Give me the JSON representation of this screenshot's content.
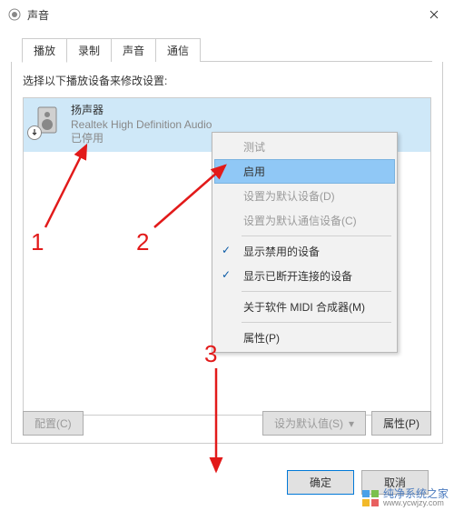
{
  "window": {
    "title": "声音"
  },
  "tabs": {
    "items": [
      {
        "label": "播放",
        "active": true
      },
      {
        "label": "录制"
      },
      {
        "label": "声音"
      },
      {
        "label": "通信"
      }
    ]
  },
  "instruction": "选择以下播放设备来修改设置:",
  "device": {
    "name": "扬声器",
    "desc": "Realtek High Definition Audio",
    "status": "已停用"
  },
  "context_menu": {
    "test": "测试",
    "enable": "启用",
    "set_default": "设置为默认设备(D)",
    "set_default_comm": "设置为默认通信设备(C)",
    "show_disabled": "显示禁用的设备",
    "show_disconnected": "显示已断开连接的设备",
    "about_midi": "关于软件 MIDI 合成器(M)",
    "properties": "属性(P)"
  },
  "inner_buttons": {
    "configure": "配置(C)",
    "set_default": "设为默认值(S)",
    "properties": "属性(P)"
  },
  "dialog_buttons": {
    "ok": "确定",
    "cancel": "取消"
  },
  "annotations": {
    "n1": "1",
    "n2": "2",
    "n3": "3"
  },
  "watermark": {
    "text": "纯净系统之家",
    "url": "www.ycwjzy.com"
  }
}
